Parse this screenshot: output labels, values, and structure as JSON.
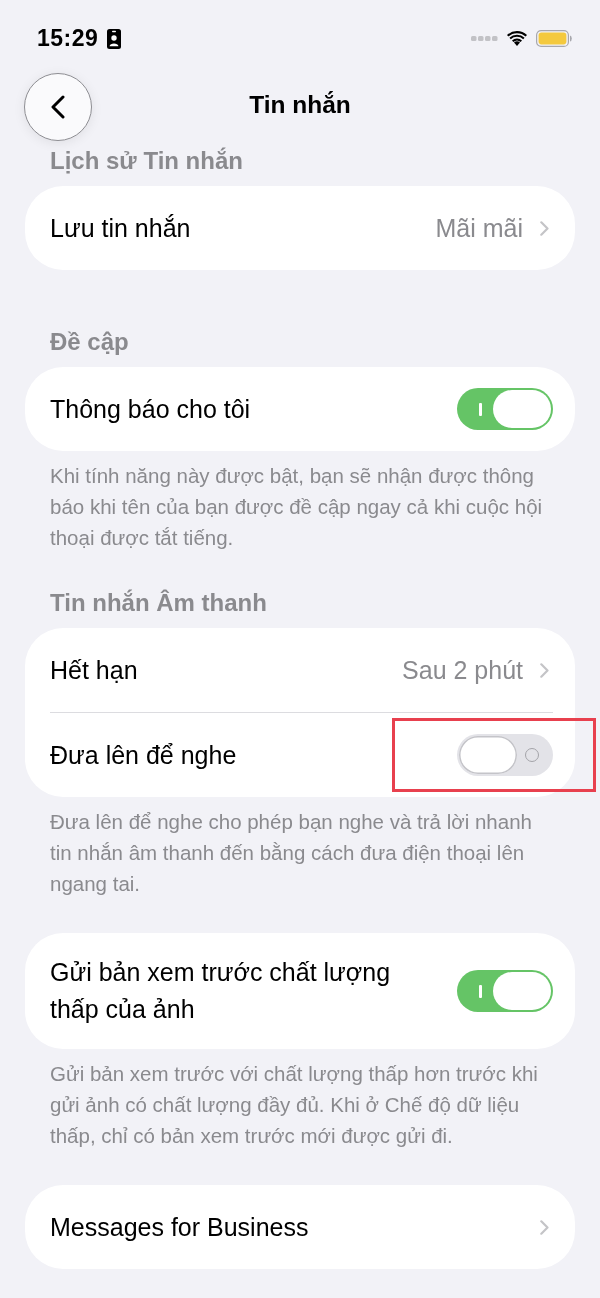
{
  "status_bar": {
    "time": "15:29"
  },
  "nav_bar": {
    "title": "Tin nhắn"
  },
  "sections": [
    {
      "header": "Lịch sử Tin nhắn",
      "rows": [
        {
          "kind": "link",
          "label": "Lưu tin nhắn",
          "value": "Mãi mãi",
          "highlighted": false
        }
      ]
    },
    {
      "header": "Đề cập",
      "rows": [
        {
          "kind": "toggle",
          "label": "Thông báo cho tôi",
          "on": true,
          "highlighted": false
        }
      ],
      "footer": "Khi tính năng này được bật, bạn sẽ nhận được thông báo khi tên của bạn được đề cập ngay cả khi cuộc hội thoại được tắt tiếng."
    },
    {
      "header": "Tin nhắn Âm thanh",
      "rows": [
        {
          "kind": "link",
          "label": "Hết hạn",
          "value": "Sau 2 phút",
          "highlighted": false
        },
        {
          "kind": "toggle",
          "label": "Đưa lên để nghe",
          "on": false,
          "highlighted": true
        }
      ],
      "footer": "Đưa lên để nghe cho phép bạn nghe và trả lời nhanh tin nhắn âm thanh đến bằng cách đưa điện thoại lên ngang tai."
    },
    {
      "rows": [
        {
          "kind": "toggle",
          "label": "Gửi bản xem trước chất lượng thấp của ảnh",
          "on": true,
          "highlighted": false
        }
      ],
      "footer": "Gửi bản xem trước với chất lượng thấp hơn trước khi gửi ảnh có chất lượng đầy đủ. Khi ở Chế độ dữ liệu thấp, chỉ có bản xem trước mới được gửi đi."
    },
    {
      "rows": [
        {
          "kind": "link",
          "label": "Messages for Business",
          "highlighted": false
        }
      ]
    }
  ]
}
